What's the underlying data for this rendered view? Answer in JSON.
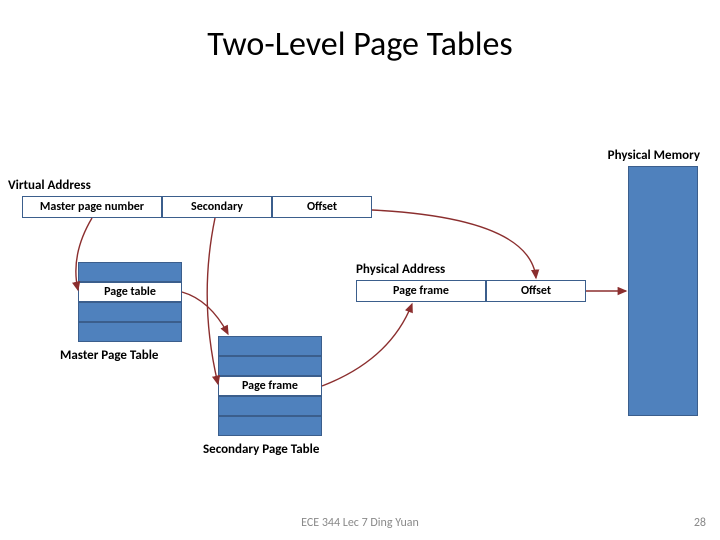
{
  "title": "Two-Level Page Tables",
  "labels": {
    "physical_memory": "Physical Memory",
    "virtual_address": "Virtual Address",
    "physical_address": "Physical Address"
  },
  "va_fields": {
    "master": "Master page number",
    "secondary": "Secondary",
    "offset": "Offset"
  },
  "master_table": {
    "entry_label": "Page table",
    "caption": "Master Page Table"
  },
  "secondary_table": {
    "entry_label": "Page frame",
    "caption": "Secondary Page Table"
  },
  "pa_fields": {
    "frame": "Page frame",
    "offset": "Offset"
  },
  "footer": {
    "text": "ECE 344 Lec 7 Ding Yuan",
    "page": "28"
  },
  "colors": {
    "block_fill": "#4f81bd",
    "block_border": "#3b5e8c",
    "arrow": "#8b2e2e"
  }
}
